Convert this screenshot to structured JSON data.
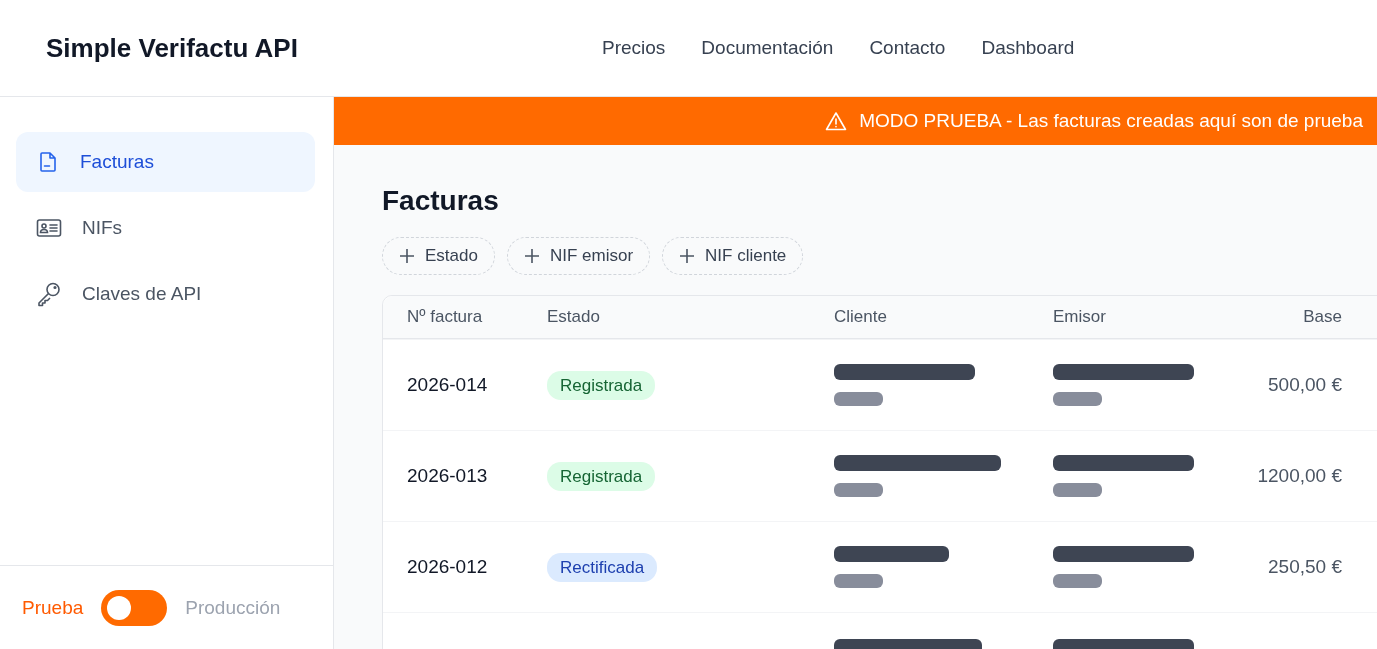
{
  "header": {
    "brand": "Simple Verifactu API",
    "nav": [
      {
        "label": "Precios"
      },
      {
        "label": "Documentación"
      },
      {
        "label": "Contacto"
      },
      {
        "label": "Dashboard"
      }
    ]
  },
  "sidebar": {
    "items": [
      {
        "label": "Facturas",
        "kind": "document",
        "selected": true
      },
      {
        "label": "NIFs",
        "kind": "id-card",
        "selected": false
      },
      {
        "label": "Claves de API",
        "kind": "key",
        "selected": false
      }
    ],
    "mode_toggle": {
      "left_label": "Prueba",
      "right_label": "Producción",
      "production": false
    }
  },
  "banner": {
    "text": "MODO PRUEBA - Las facturas creadas aquí son de prueba"
  },
  "page_title": "Facturas",
  "filters": [
    {
      "label": "Estado"
    },
    {
      "label": "NIF emisor"
    },
    {
      "label": "NIF cliente"
    }
  ],
  "table": {
    "columns": [
      "Nº factura",
      "Estado",
      "Cliente",
      "Emisor",
      "Base"
    ],
    "rows": [
      {
        "number": "2026-014",
        "status": "Registrada",
        "kind": "registered",
        "base": "500,00 €"
      },
      {
        "number": "2026-013",
        "status": "Registrada",
        "kind": "registered",
        "base": "1200,00 €"
      },
      {
        "number": "2026-012",
        "status": "Rectificada",
        "kind": "rectified",
        "base": "250,50 €"
      }
    ]
  }
}
